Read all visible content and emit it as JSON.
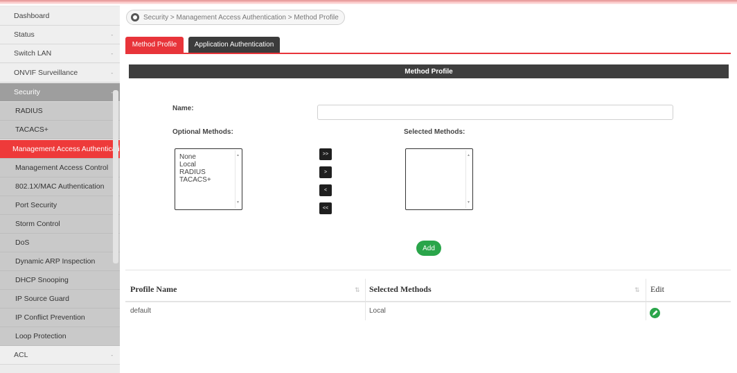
{
  "sidebar": {
    "items": [
      {
        "label": "Dashboard",
        "caret": ""
      },
      {
        "label": "Status",
        "caret": "-"
      },
      {
        "label": "Switch LAN",
        "caret": "-"
      },
      {
        "label": "ONVIF Surveillance",
        "caret": "-"
      },
      {
        "label": "Security",
        "caret": "-"
      }
    ],
    "security_items": [
      "RADIUS",
      "TACACS+",
      "Management Access Authenticati",
      "Management Access Control",
      "802.1X/MAC Authentication",
      "Port Security",
      "Storm Control",
      "DoS",
      "Dynamic ARP Inspection",
      "DHCP Snooping",
      "IP Source Guard",
      "IP Conflict Prevention",
      "Loop Protection"
    ],
    "bottom_items": [
      {
        "label": "ACL",
        "caret": "-"
      }
    ]
  },
  "breadcrumb": "Security > Management Access Authentication > Method Profile",
  "tabs": [
    "Method Profile",
    "Application Authentication"
  ],
  "section_title": "Method Profile",
  "form": {
    "name_label": "Name:",
    "name_value": "",
    "optional_label": "Optional Methods:",
    "selected_label": "Selected Methods:",
    "optional_options": [
      "None",
      "Local",
      "RADIUS",
      "TACACS+"
    ],
    "selected_options": [],
    "move_buttons": [
      ">>",
      ">",
      "<",
      "<<"
    ],
    "add_label": "Add"
  },
  "table": {
    "headers": [
      "Profile Name",
      "Selected Methods",
      "Edit"
    ],
    "rows": [
      {
        "profile_name": "default",
        "selected_methods": "Local"
      }
    ]
  },
  "colors": {
    "accent": "#e8343a",
    "dark": "#3e3e3e",
    "green": "#2aa54a"
  }
}
